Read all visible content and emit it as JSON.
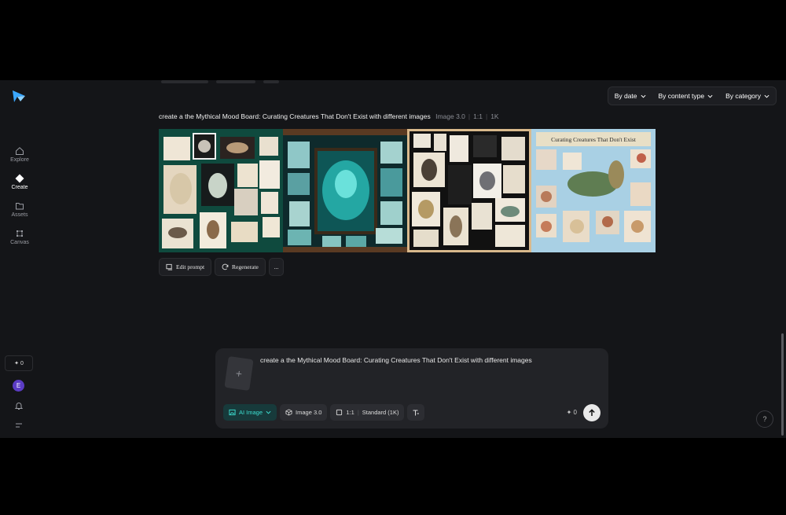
{
  "sidebar": {
    "items": [
      {
        "label": "Explore",
        "icon": "home-icon"
      },
      {
        "label": "Create",
        "icon": "sparkle-icon"
      },
      {
        "label": "Assets",
        "icon": "folder-icon"
      },
      {
        "label": "Canvas",
        "icon": "canvas-icon"
      }
    ],
    "credits": "0",
    "avatar_letter": "E"
  },
  "filters": [
    "By date",
    "By content type",
    "By category"
  ],
  "generation": {
    "prompt": "create a the Mythical Mood Board: Curating Creatures That Don't Exist with different images",
    "model": "Image 3.0",
    "ratio": "1:1",
    "resolution": "1K",
    "image4_caption": "Curating Creatures That Don't Exist"
  },
  "actions": {
    "edit": "Edit prompt",
    "regenerate": "Regenerate",
    "more": "..."
  },
  "composer": {
    "prompt": "create a the Mythical Mood Board: Curating Creatures That Don't Exist with different images",
    "mode": "AI Image",
    "model": "Image 3.0",
    "ratio": "1:1",
    "quality": "Standard (1K)",
    "cost": "0"
  },
  "colors": {
    "accent": "#3ddfd1",
    "background": "#141518",
    "card": "#222327"
  }
}
